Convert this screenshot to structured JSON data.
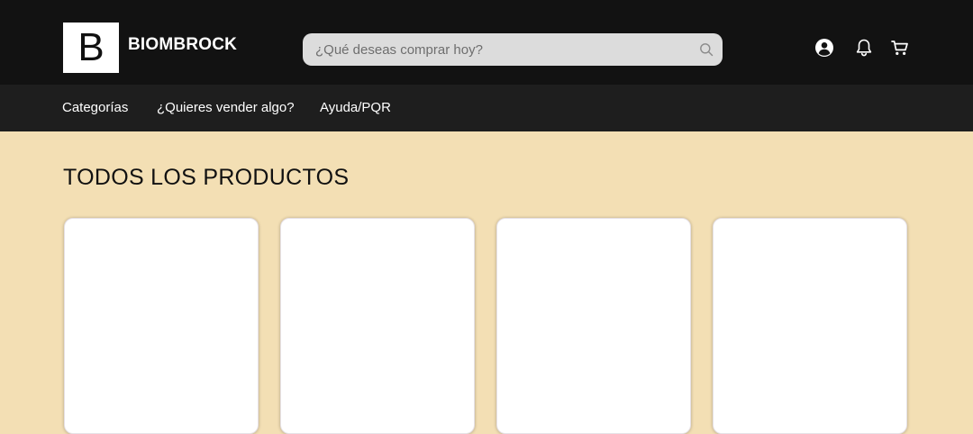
{
  "header": {
    "logo_letter": "B",
    "brand_name": "BIOMBROCK",
    "search": {
      "placeholder": "¿Qué deseas comprar hoy?",
      "value": ""
    },
    "icons": [
      "user-icon",
      "bell-icon",
      "cart-icon"
    ]
  },
  "nav": {
    "items": [
      {
        "label": "Categorías"
      },
      {
        "label": "¿Quieres vender algo?"
      },
      {
        "label": "Ayuda/PQR"
      }
    ]
  },
  "main": {
    "title": "TODOS LOS PRODUCTOS",
    "product_cards": 4
  },
  "colors": {
    "topbar": "#121212",
    "navbar": "#1e1e1e",
    "background": "#f3dfb4",
    "card": "#ffffff",
    "search_bg": "#dcdcdc"
  }
}
